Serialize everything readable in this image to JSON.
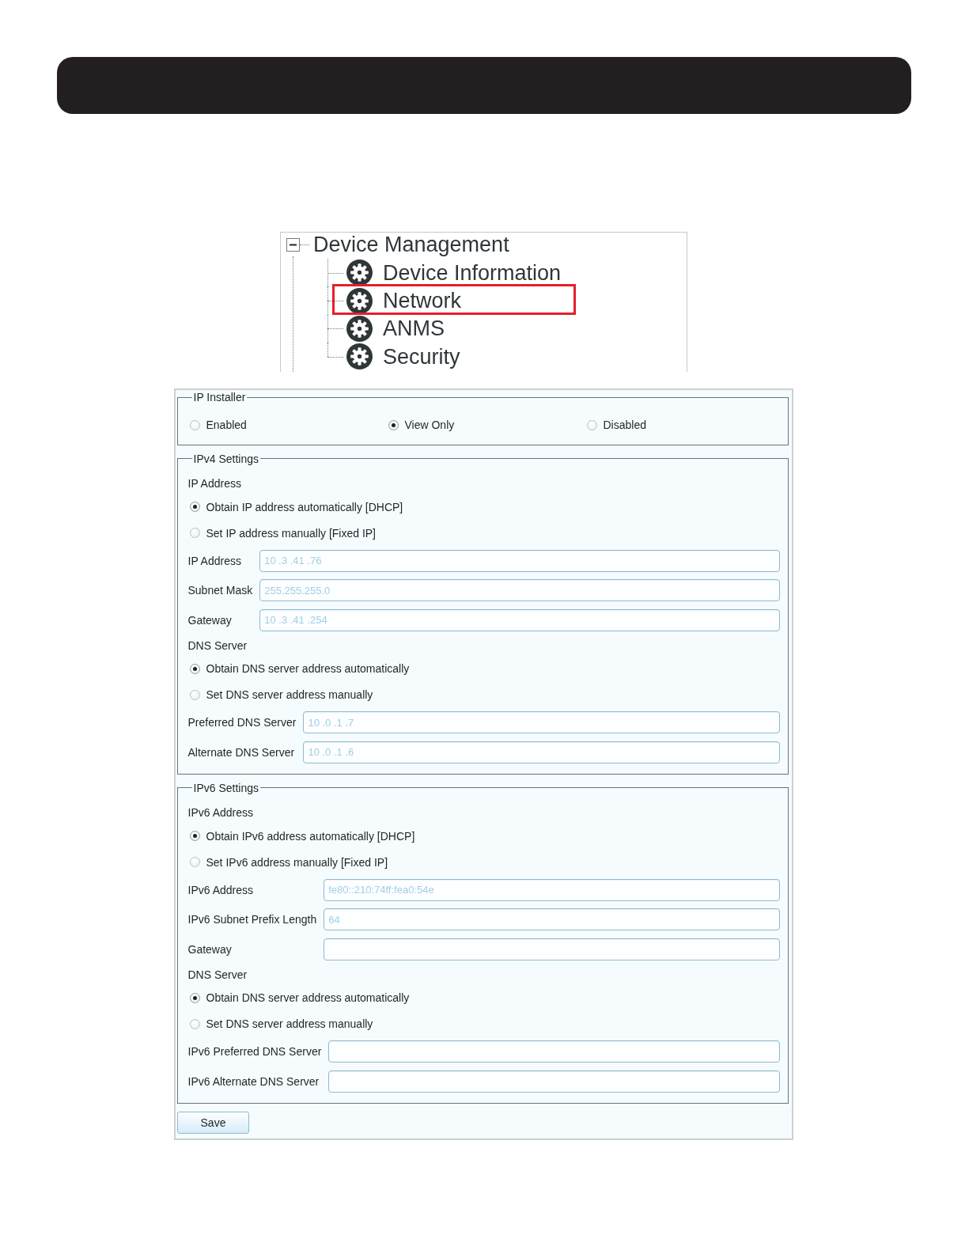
{
  "tree": {
    "label": "Device Management",
    "expanded": true,
    "children": [
      {
        "label": "Device Information",
        "highlighted": false
      },
      {
        "label": "Network",
        "highlighted": true
      },
      {
        "label": "ANMS",
        "highlighted": false
      },
      {
        "label": "Security",
        "highlighted": false
      }
    ]
  },
  "form": {
    "sections": [
      {
        "legend": "IP Installer",
        "blocks": [
          {
            "kind": "inline_radios",
            "options": [
              {
                "label": "Enabled",
                "selected": false
              },
              {
                "label": "View Only",
                "selected": true
              },
              {
                "label": "Disabled",
                "selected": false
              }
            ]
          }
        ]
      },
      {
        "legend": "IPv4 Settings",
        "blocks": [
          {
            "kind": "heading",
            "text": "IP Address"
          },
          {
            "kind": "radios",
            "options": [
              {
                "label": "Obtain IP address automatically [DHCP]",
                "selected": true
              },
              {
                "label": "Set IP address manually [Fixed IP]",
                "selected": false
              }
            ]
          },
          {
            "kind": "fields",
            "fields": [
              {
                "label": "IP Address",
                "value": "10 .3 .41 .76",
                "disabled": true
              },
              {
                "label": "Subnet Mask",
                "value": "255.255.255.0",
                "disabled": true
              },
              {
                "label": "Gateway",
                "value": "10 .3 .41 .254",
                "disabled": true
              }
            ]
          },
          {
            "kind": "heading",
            "text": "DNS Server"
          },
          {
            "kind": "radios",
            "options": [
              {
                "label": "Obtain DNS server address automatically",
                "selected": true
              },
              {
                "label": "Set DNS server address manually",
                "selected": false
              }
            ]
          },
          {
            "kind": "fields",
            "fields": [
              {
                "label": "Preferred DNS Server",
                "value": "10 .0 .1 .7",
                "disabled": true
              },
              {
                "label": "Alternate DNS Server",
                "value": "10 .0 .1 .6",
                "disabled": true
              }
            ]
          }
        ]
      },
      {
        "legend": "IPv6 Settings",
        "blocks": [
          {
            "kind": "heading",
            "text": "IPv6 Address"
          },
          {
            "kind": "radios",
            "options": [
              {
                "label": "Obtain IPv6 address automatically [DHCP]",
                "selected": true
              },
              {
                "label": "Set IPv6 address manually [Fixed IP]",
                "selected": false
              }
            ]
          },
          {
            "kind": "fields",
            "fields": [
              {
                "label": "IPv6 Address",
                "value": "fe80::210:74ff:fea0:54e",
                "disabled": true
              },
              {
                "label": "IPv6 Subnet Prefix Length",
                "value": "64",
                "disabled": true
              },
              {
                "label": "Gateway"
              }
            ]
          },
          {
            "kind": "heading",
            "text": "DNS Server"
          },
          {
            "kind": "radios",
            "options": [
              {
                "label": "Obtain DNS server address automatically",
                "selected": true
              },
              {
                "label": "Set DNS server address manually",
                "selected": false
              }
            ]
          },
          {
            "kind": "fields",
            "fields": [
              {
                "label": "IPv6 Preferred DNS Server"
              },
              {
                "label": "IPv6 Alternate DNS Server"
              }
            ]
          }
        ]
      }
    ],
    "save_button": "Save"
  }
}
